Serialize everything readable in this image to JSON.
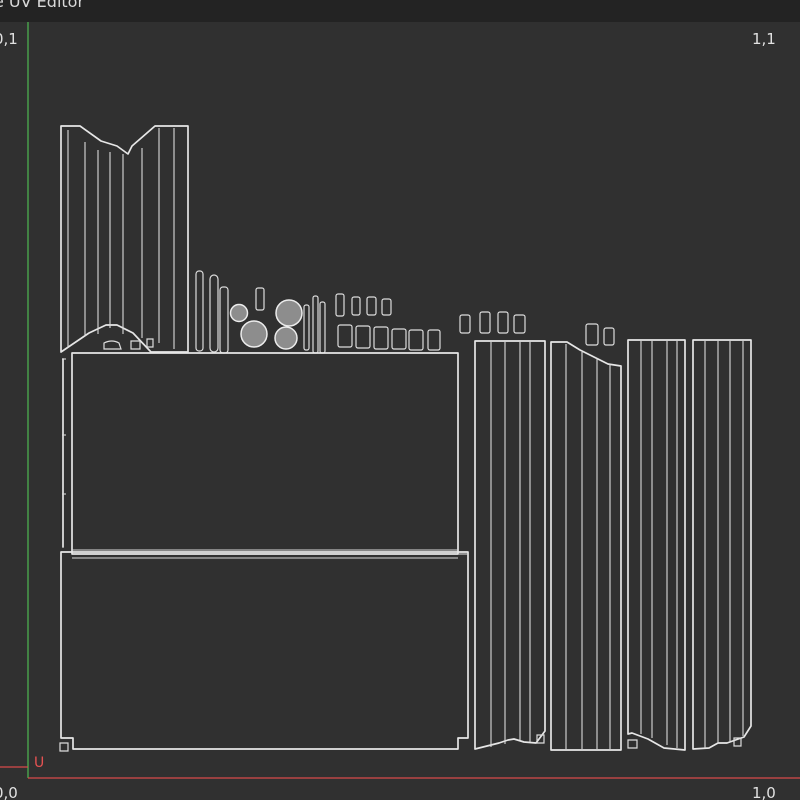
{
  "window": {
    "title": "e UV Editor"
  },
  "uv_space": {
    "corner_top_left": "0,1",
    "corner_top_right": "1,1",
    "corner_bottom_left": "0,0",
    "corner_bottom_right": "1,0",
    "u_axis_label": "U"
  },
  "colors": {
    "background": "#303030",
    "title_bar": "#232323",
    "u_axis": "#d84a4a",
    "v_axis": "#4caf50",
    "uv_island": "#e6e6e6"
  },
  "icons": {
    "u_axis": "axis-line",
    "v_axis": "axis-line"
  }
}
